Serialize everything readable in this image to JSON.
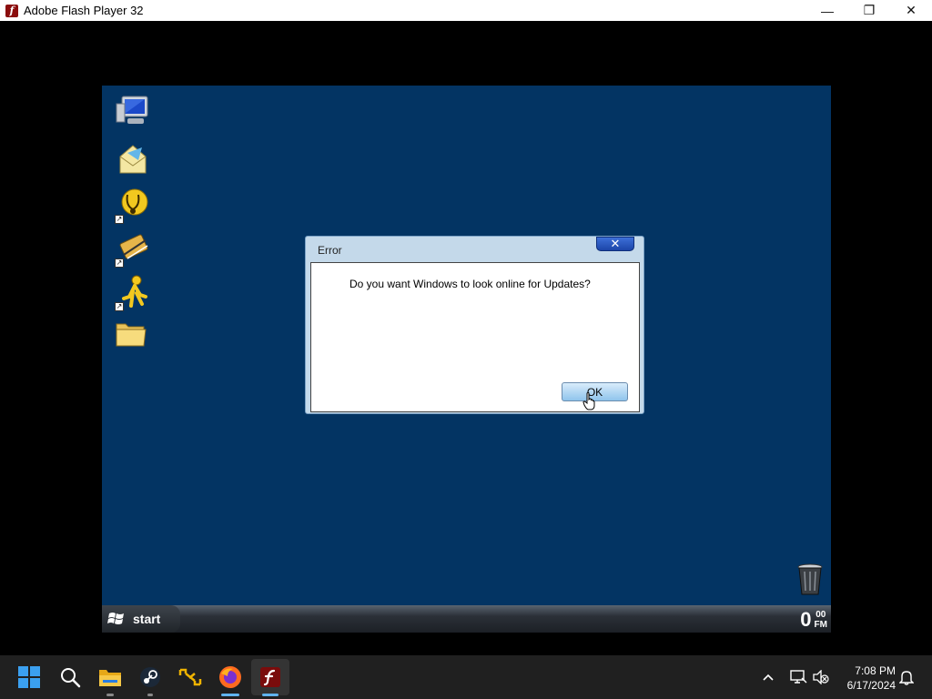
{
  "window": {
    "title": "Adobe Flash Player 32",
    "minimize_glyph": "—",
    "maximize_glyph": "❐",
    "close_glyph": "✕"
  },
  "desktop": {
    "background": "#033463",
    "icons": [
      {
        "name": "computer-icon"
      },
      {
        "name": "outlook-express-icon"
      },
      {
        "name": "help-support-icon"
      },
      {
        "name": "control-panel-icon"
      },
      {
        "name": "aim-icon"
      },
      {
        "name": "folder-icon"
      }
    ],
    "recycle_bin": "recycle-bin-icon"
  },
  "dialog": {
    "title": "Error",
    "close_glyph": "✕",
    "message": "Do you want Windows to look online for  Updates?",
    "ok_label": "OK"
  },
  "xp_taskbar": {
    "start_label": "start",
    "clock_hour": "0",
    "clock_minutes": "00",
    "clock_period": "FM"
  },
  "win_taskbar": {
    "apps": [
      "start-icon",
      "search-icon",
      "file-explorer-icon",
      "steam-icon",
      "vscode-icon",
      "firefox-icon",
      "flash-player-icon"
    ],
    "tray": {
      "time": "7:08 PM",
      "date": "6/17/2024",
      "chevron_glyph": "^"
    }
  }
}
